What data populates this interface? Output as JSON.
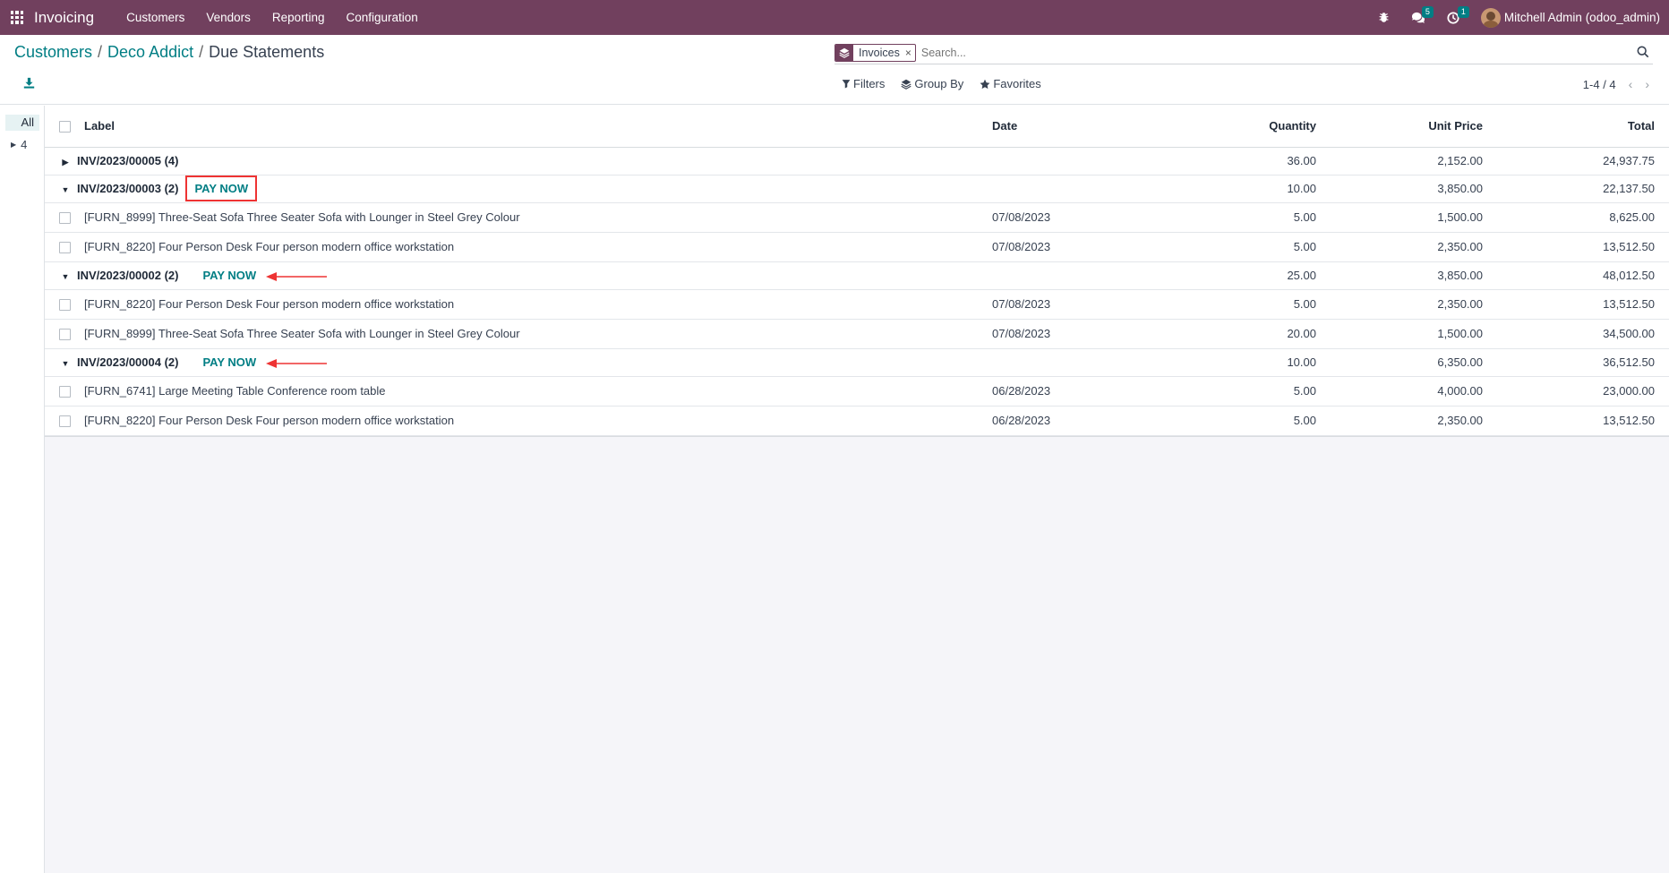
{
  "navbar": {
    "brand": "Invoicing",
    "menus": [
      "Customers",
      "Vendors",
      "Reporting",
      "Configuration"
    ],
    "discuss_badge": "5",
    "activity_badge": "1",
    "user": "Mitchell Admin (odoo_admin)"
  },
  "breadcrumb": {
    "items": [
      "Customers",
      "Deco Addict"
    ],
    "current": "Due Statements"
  },
  "search": {
    "facet": "Invoices",
    "facet_remove": "×",
    "placeholder": "Search..."
  },
  "filters": {
    "filters_label": "Filters",
    "groupby_label": "Group By",
    "favorites_label": "Favorites"
  },
  "pager": {
    "value": "1-4 / 4",
    "prev": "‹",
    "next": "›"
  },
  "side": {
    "all_label": "All",
    "item_label": "4"
  },
  "table": {
    "headers": {
      "label": "Label",
      "date": "Date",
      "quantity": "Quantity",
      "unit_price": "Unit Price",
      "total": "Total"
    },
    "pay_now_label": "PAY NOW",
    "groups": [
      {
        "name": "INV/2023/00005 (4)",
        "expanded": false,
        "pay_now": false,
        "quantity": "36.00",
        "unit_price": "2,152.00",
        "total": "24,937.75",
        "lines": []
      },
      {
        "name": "INV/2023/00003 (2)",
        "expanded": true,
        "pay_now": true,
        "highlight": "box",
        "quantity": "10.00",
        "unit_price": "3,850.00",
        "total": "22,137.50",
        "lines": [
          {
            "label": "[FURN_8999] Three-Seat Sofa Three Seater Sofa with Lounger in Steel Grey Colour",
            "date": "07/08/2023",
            "quantity": "5.00",
            "unit_price": "1,500.00",
            "total": "8,625.00"
          },
          {
            "label": "[FURN_8220] Four Person Desk Four person modern office workstation",
            "date": "07/08/2023",
            "quantity": "5.00",
            "unit_price": "2,350.00",
            "total": "13,512.50"
          }
        ]
      },
      {
        "name": "INV/2023/00002 (2)",
        "expanded": true,
        "pay_now": true,
        "highlight": "arrow",
        "quantity": "25.00",
        "unit_price": "3,850.00",
        "total": "48,012.50",
        "lines": [
          {
            "label": "[FURN_8220] Four Person Desk Four person modern office workstation",
            "date": "07/08/2023",
            "quantity": "5.00",
            "unit_price": "2,350.00",
            "total": "13,512.50"
          },
          {
            "label": "[FURN_8999] Three-Seat Sofa Three Seater Sofa with Lounger in Steel Grey Colour",
            "date": "07/08/2023",
            "quantity": "20.00",
            "unit_price": "1,500.00",
            "total": "34,500.00"
          }
        ]
      },
      {
        "name": "INV/2023/00004 (2)",
        "expanded": true,
        "pay_now": true,
        "highlight": "arrow",
        "quantity": "10.00",
        "unit_price": "6,350.00",
        "total": "36,512.50",
        "lines": [
          {
            "label": "[FURN_6741] Large Meeting Table Conference room table",
            "date": "06/28/2023",
            "quantity": "5.00",
            "unit_price": "4,000.00",
            "total": "23,000.00"
          },
          {
            "label": "[FURN_8220] Four Person Desk Four person modern office workstation",
            "date": "06/28/2023",
            "quantity": "5.00",
            "unit_price": "2,350.00",
            "total": "13,512.50"
          }
        ]
      }
    ]
  },
  "colors": {
    "navbar": "#71405e",
    "accent": "#017e84",
    "annotation": "#ee3333"
  }
}
